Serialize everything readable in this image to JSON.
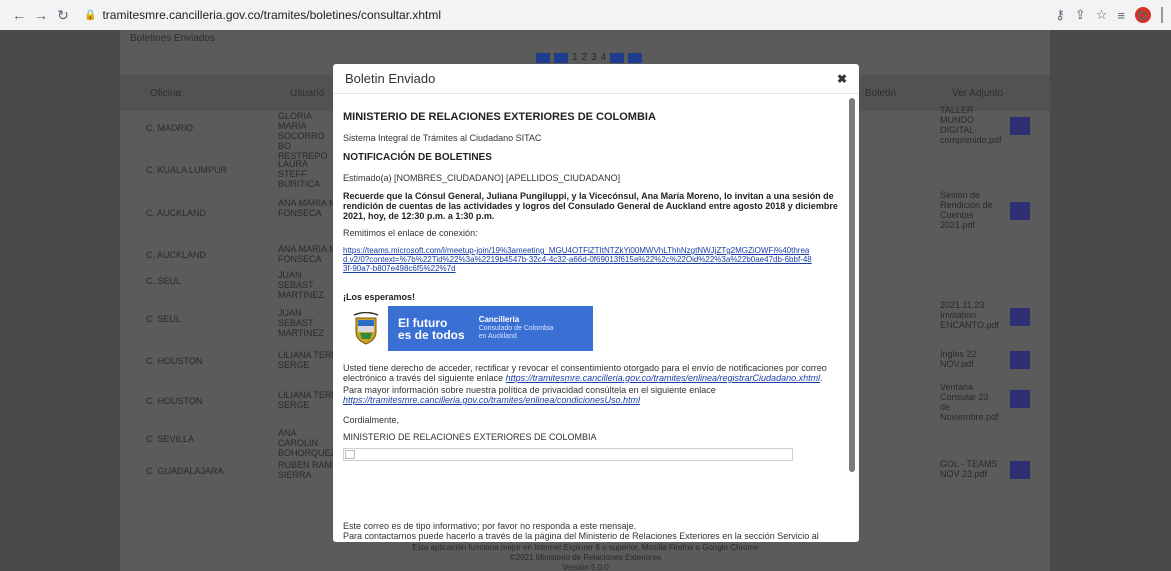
{
  "browser": {
    "url": "tramitesmre.cancilleria.gov.co/tramites/boletines/consultar.xhtml",
    "profile_initial": "D"
  },
  "page": {
    "title": "Boletines Enviados",
    "pager": [
      "1",
      "2",
      "3",
      "4"
    ],
    "columns": {
      "office": "Oficina",
      "user": "Usuario",
      "bulletin": "Boletín",
      "attachment": "Ver Adjunto"
    },
    "rows": [
      {
        "office": "C. MADRID",
        "user": "GLORIA MARÍA SOCORRO BO RESTREPO",
        "attachment": "TALLER MUNDO DIGITAL-comprimido.pdf"
      },
      {
        "office": "C. KUALA LUMPUR",
        "user": "LAURA STEFF BURITICA",
        "attachment": ""
      },
      {
        "office": "C. AUCKLAND",
        "user": "ANA MARIA M FONSECA",
        "attachment": "Sesión de Rendición de Cuentas 2021.pdf"
      },
      {
        "office": "C. AUCKLAND",
        "user": "ANA MARIA M FONSECA",
        "attachment": ""
      },
      {
        "office": "C. SEUL",
        "user": "JUAN SEBAST MARTINEZ",
        "attachment": ""
      },
      {
        "office": "C. SEUL",
        "user": "JUAN SEBAST MARTINEZ",
        "attachment": "2021.11.23 Invitation ENCANTO.pdf"
      },
      {
        "office": "C. HOUSTON",
        "user": "LILIANA TERE SERGE",
        "attachment": "Ingles 22 NOV.pdf"
      },
      {
        "office": "C. HOUSTON",
        "user": "LILIANA TERE SERGE",
        "attachment": "Ventana Consular 23 de Noviembre.pdf"
      },
      {
        "office": "C. SEVILLA",
        "user": "ANA CAROLIN BOHORQUEZ",
        "attachment": ""
      },
      {
        "office": "C. GUADALAJARA",
        "user": "RUBEN RAMI SIERRA",
        "attachment": "GOL - TEAMS NOV 23.pdf"
      }
    ],
    "footer": {
      "line1": "Esta aplicación funciona mejor en Internet Explorer 8 o superior, Mozilla Firefox o Google Chrome",
      "line2": "©2021 Ministerio de Relaciones Exteriores",
      "line3": "Versión 5.0.0"
    }
  },
  "modal": {
    "title": "Boletin Enviado",
    "heading": "MINISTERIO DE RELACIONES EXTERIORES DE COLOMBIA",
    "system": "Sistema Integral de Trámites al Ciudadano SITAC",
    "notif_title": "NOTIFICACIÓN DE BOLETINES",
    "greeting": "Estimado(a) [NOMBRES_CIUDADANO] [APELLIDOS_CIUDADANO]",
    "message": "Recuerde que la Cónsul General, Juliana Pungiluppi, y la Vicecónsul, Ana María Moreno, lo invitan a una sesión de rendición de cuentas de las actividades y logros del Consulado General de Auckland entre agosto 2018 y diciembre 2021, hoy, de 12:30 p.m. a 1:30 p.m.",
    "link_intro": "Remitimos el enlace de conexión:",
    "meeting_link": "https://teams.microsoft.com/l/meetup-join/19%3ameeting_MGU4OTFlZTItNTZkYi00MWVhLThhNzgtNWJjZTg2MGZiOWFi%40thread.v2/0?context=%7b%22Tid%22%3a%2219b4547b-32c4-4c32-a66d-0f69013f615a%22%2c%22Oid%22%3a%22b0ae47db-6bbf-483f-90a7-b807e498c6f5%22%7d",
    "closing_bold": "¡Los esperamos!",
    "banner": {
      "main_line1": "El futuro",
      "main_line2": "es de todos",
      "org": "Cancillería",
      "sub_line1": "Consulado de Colombia",
      "sub_line2": "en Auckland"
    },
    "rights_text_1": "Usted tiene derecho de acceder, rectificar y revocar el consentimiento otorgado para el envío de notificaciones por correo electrónico a través del siguiente enlace",
    "rights_link": "https://tramitesmre.cancilleria.gov.co/tramites/enlinea/registrarCiudadano.xhtml",
    "privacy_text": "Para mayor información sobre nuestra política de privacidad consúltela en el siguiente enlace",
    "privacy_link": "https://tramitesmre.cancilleria.gov.co/tramites/enlinea/condicionesUso.html",
    "regards": "Cordialmente,",
    "signature": "MINISTERIO DE RELACIONES EXTERIORES DE COLOMBIA",
    "footer_note_1": "Este correo es de tipo informativo; por favor no responda a este mensaje.",
    "footer_note_2": "Para contactarnos puede hacerlo a través de la página del Ministerio de Relaciones Exteriores en la sección Servicio al ciudadano:"
  }
}
